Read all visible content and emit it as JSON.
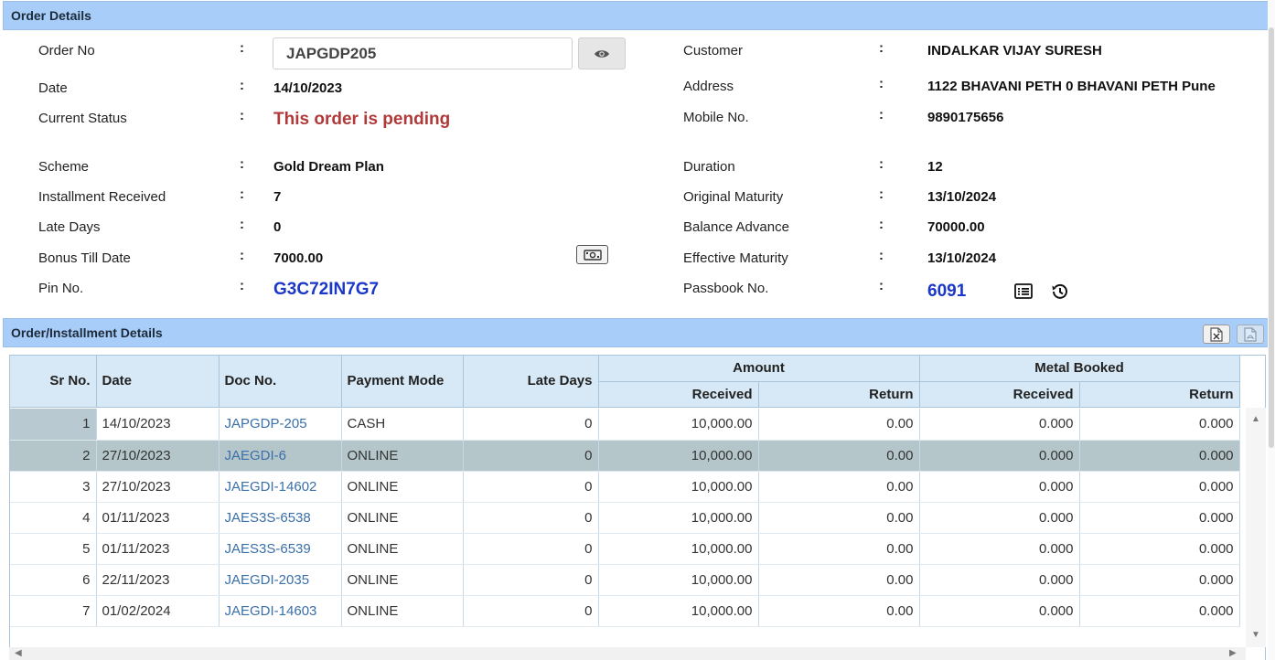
{
  "order_panel": {
    "title": "Order Details",
    "left": [
      {
        "label": "Order No",
        "value": ""
      },
      {
        "label": "Date",
        "value": "14/10/2023"
      },
      {
        "label": "Current Status",
        "value": "This order is pending"
      },
      {
        "label": "Scheme",
        "value": "Gold Dream Plan"
      },
      {
        "label": "Installment Received",
        "value": "7"
      },
      {
        "label": "Late Days",
        "value": "0"
      },
      {
        "label": "Bonus Till Date",
        "value": "7000.00"
      },
      {
        "label": "Pin No.",
        "value": "G3C72IN7G7"
      }
    ],
    "right": [
      {
        "label": "Customer",
        "value": "INDALKAR VIJAY SURESH"
      },
      {
        "label": "Address",
        "value": "1122 BHAVANI PETH 0 BHAVANI PETH Pune"
      },
      {
        "label": "Mobile No.",
        "value": "9890175656"
      },
      {
        "label": "Duration",
        "value": "12"
      },
      {
        "label": "Original Maturity",
        "value": "13/10/2024"
      },
      {
        "label": "Balance Advance",
        "value": "70000.00"
      },
      {
        "label": "Effective Maturity",
        "value": "13/10/2024"
      },
      {
        "label": "Passbook No.",
        "value": "6091"
      }
    ],
    "order_no_input": "JAPGDP205",
    "colon": ":"
  },
  "installment_panel": {
    "title": "Order/Installment Details",
    "headers": {
      "sr_no": "Sr No.",
      "date": "Date",
      "doc_no": "Doc No.",
      "payment_mode": "Payment Mode",
      "late_days": "Late Days",
      "amount": "Amount",
      "metal_booked": "Metal Booked",
      "received": "Received",
      "return": "Return"
    },
    "rows": [
      {
        "sr": "1",
        "date": "14/10/2023",
        "doc": "JAPGDP-205",
        "mode": "CASH",
        "late": "0",
        "amt_recv": "10,000.00",
        "amt_ret": "0.00",
        "metal_recv": "0.000",
        "metal_ret": "0.000"
      },
      {
        "sr": "2",
        "date": "27/10/2023",
        "doc": "JAEGDI-6",
        "mode": "ONLINE",
        "late": "0",
        "amt_recv": "10,000.00",
        "amt_ret": "0.00",
        "metal_recv": "0.000",
        "metal_ret": "0.000"
      },
      {
        "sr": "3",
        "date": "27/10/2023",
        "doc": "JAEGDI-14602",
        "mode": "ONLINE",
        "late": "0",
        "amt_recv": "10,000.00",
        "amt_ret": "0.00",
        "metal_recv": "0.000",
        "metal_ret": "0.000"
      },
      {
        "sr": "4",
        "date": "01/11/2023",
        "doc": "JAES3S-6538",
        "mode": "ONLINE",
        "late": "0",
        "amt_recv": "10,000.00",
        "amt_ret": "0.00",
        "metal_recv": "0.000",
        "metal_ret": "0.000"
      },
      {
        "sr": "5",
        "date": "01/11/2023",
        "doc": "JAES3S-6539",
        "mode": "ONLINE",
        "late": "0",
        "amt_recv": "10,000.00",
        "amt_ret": "0.00",
        "metal_recv": "0.000",
        "metal_ret": "0.000"
      },
      {
        "sr": "6",
        "date": "22/11/2023",
        "doc": "JAEGDI-2035",
        "mode": "ONLINE",
        "late": "0",
        "amt_recv": "10,000.00",
        "amt_ret": "0.00",
        "metal_recv": "0.000",
        "metal_ret": "0.000"
      },
      {
        "sr": "7",
        "date": "01/02/2024",
        "doc": "JAEGDI-14603",
        "mode": "ONLINE",
        "late": "0",
        "amt_recv": "10,000.00",
        "amt_ret": "0.00",
        "metal_recv": "0.000",
        "metal_ret": "0.000"
      }
    ],
    "selected_row": 2
  },
  "icons": {
    "view": "eye-icon",
    "bonus": "cash-icon",
    "passbook": "list-icon",
    "history": "history-icon",
    "excel": "excel-export-icon",
    "pdf": "pdf-export-icon"
  },
  "colors": {
    "header_bg": "#a8cdf8",
    "status": "#b03a3a",
    "highlight_value": "#1a37c8",
    "link": "#3a6fa8",
    "selected_row": "#b5c6ca"
  }
}
